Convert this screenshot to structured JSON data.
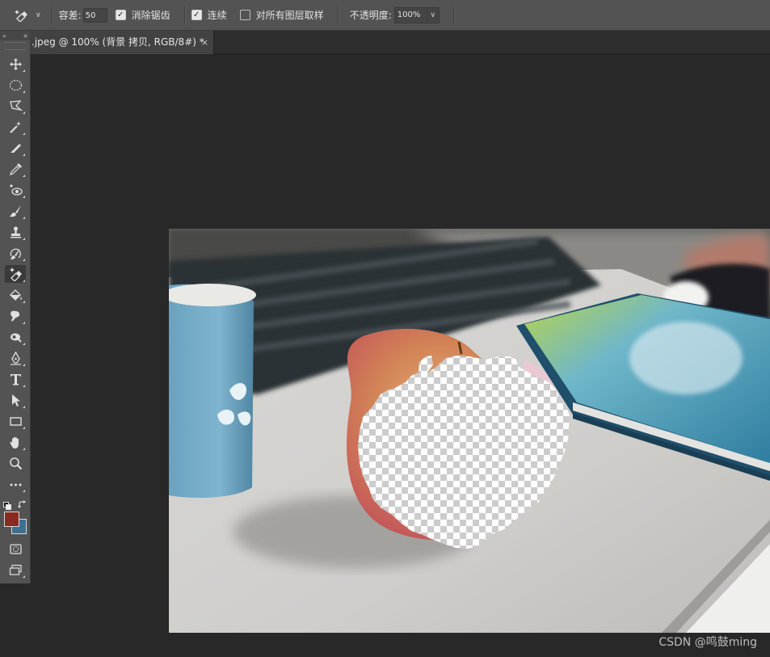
{
  "options": {
    "tool_icon": "magic-eraser-icon",
    "tolerance_label": "容差:",
    "tolerance_value": "50",
    "antialias_label": "消除锯齿",
    "antialias_checked": true,
    "contiguous_label": "连续",
    "contiguous_checked": true,
    "sample_all_label": "对所有图层取样",
    "sample_all_checked": false,
    "opacity_label": "不透明度:",
    "opacity_value": "100%"
  },
  "panel_header": {
    "collapse_glyph": "»",
    "close_glyph": "×"
  },
  "document": {
    "tab_title": ".jpeg @ 100% (背景 拷贝, RGB/8#) *",
    "close_glyph": "×"
  },
  "tools": [
    {
      "name": "move-tool",
      "icon": "move-icon"
    },
    {
      "name": "elliptical-marquee-tool",
      "icon": "ellipse-marquee-icon"
    },
    {
      "name": "polygonal-lasso-tool",
      "icon": "lasso-icon"
    },
    {
      "name": "magic-wand-tool",
      "icon": "magic-wand-icon"
    },
    {
      "name": "slice-tool",
      "icon": "slice-icon"
    },
    {
      "name": "eyedropper-tool",
      "icon": "eyedropper-icon"
    },
    {
      "name": "red-eye-tool",
      "icon": "red-eye-icon"
    },
    {
      "name": "brush-tool",
      "icon": "brush-icon"
    },
    {
      "name": "clone-stamp-tool",
      "icon": "stamp-icon"
    },
    {
      "name": "history-brush-tool",
      "icon": "history-brush-icon"
    },
    {
      "name": "magic-eraser-tool",
      "icon": "magic-eraser-icon",
      "active": true
    },
    {
      "name": "paint-bucket-tool",
      "icon": "paint-bucket-icon"
    },
    {
      "name": "smudge-tool",
      "icon": "smudge-icon"
    },
    {
      "name": "burn-tool",
      "icon": "burn-icon"
    },
    {
      "name": "pen-tool",
      "icon": "pen-icon"
    },
    {
      "name": "type-tool",
      "icon": "type-icon"
    },
    {
      "name": "path-selection-tool",
      "icon": "arrow-select-icon"
    },
    {
      "name": "rectangle-tool",
      "icon": "rectangle-icon"
    },
    {
      "name": "hand-tool",
      "icon": "hand-icon"
    },
    {
      "name": "zoom-tool",
      "icon": "zoom-icon"
    },
    {
      "name": "edit-toolbar",
      "icon": "more-icon"
    }
  ],
  "colors": {
    "foreground": "#8b2a23",
    "background": "#3f6f8f"
  },
  "watermark": "CSDN @鸣鼓ming"
}
